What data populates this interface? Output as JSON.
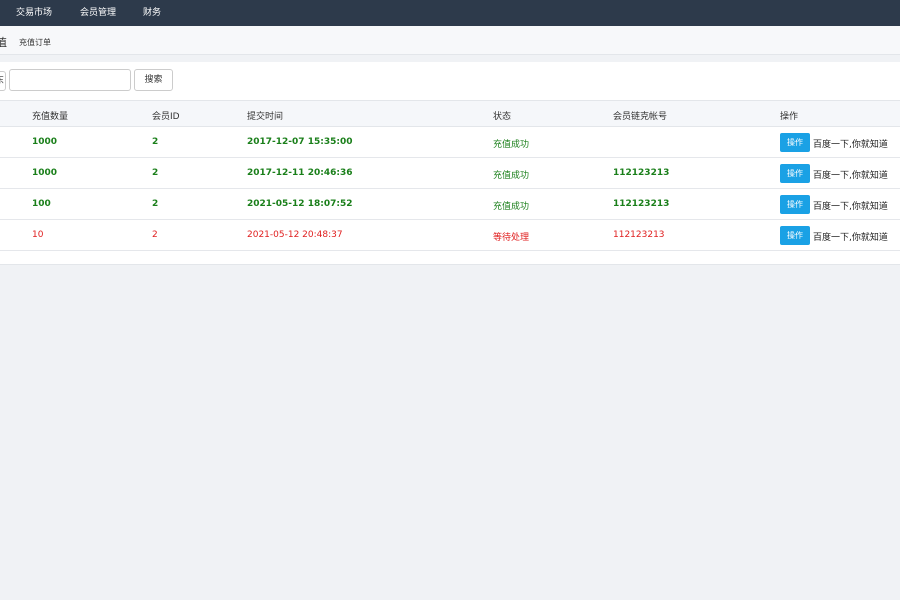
{
  "nav": {
    "items": [
      "交易市场",
      "会员管理",
      "财务"
    ]
  },
  "subbar": {
    "page_title": "值",
    "breadcrumb": "充值订单"
  },
  "search": {
    "label": "东",
    "placeholder": "",
    "button_label": "搜索"
  },
  "table": {
    "headers": [
      "充值数量",
      "会员ID",
      "提交时间",
      "状态",
      "会员链克帐号",
      "操作"
    ],
    "rows": [
      {
        "amount": "1000",
        "member_id": "2",
        "time": "2017-12-07 15:35:00",
        "status": "充值成功",
        "account": "",
        "action": "操作",
        "link": "百度一下,你就知道"
      },
      {
        "amount": "1000",
        "member_id": "2",
        "time": "2017-12-11 20:46:36",
        "status": "充值成功",
        "account": "112123213",
        "action": "操作",
        "link": "百度一下,你就知道"
      },
      {
        "amount": "100",
        "member_id": "2",
        "time": "2021-05-12 18:07:52",
        "status": "充值成功",
        "account": "112123213",
        "action": "操作",
        "link": "百度一下,你就知道"
      },
      {
        "amount": "10",
        "member_id": "2",
        "time": "2021-05-12 20:48:37",
        "status": "等待处理",
        "account": "112123213",
        "action": "操作",
        "link": "百度一下,你就知道"
      }
    ]
  },
  "colors": {
    "topbar": "#2d3a4b",
    "success": "#1a7f1a",
    "pending": "#e02020",
    "button": "#1aa1e5"
  }
}
